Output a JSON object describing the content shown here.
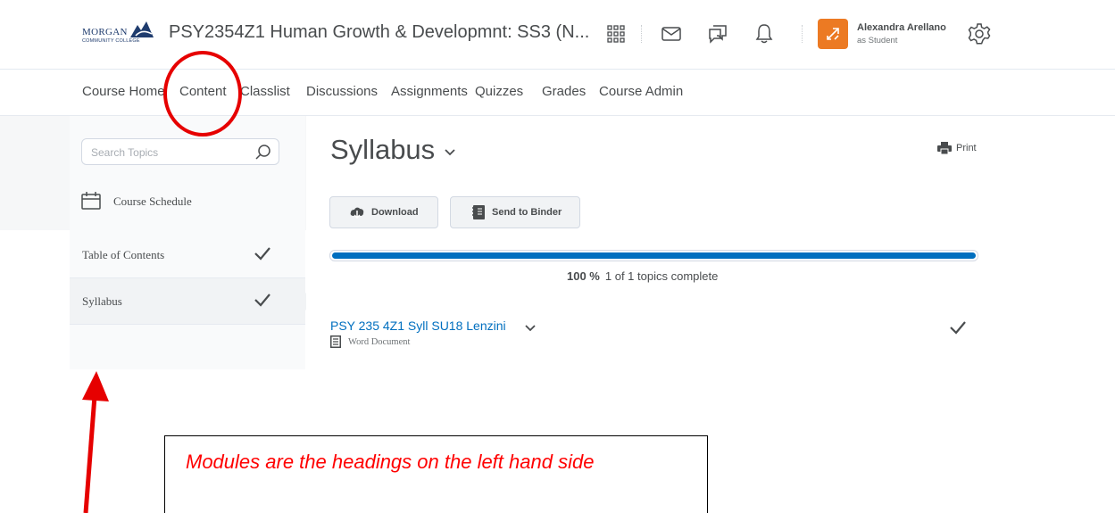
{
  "header": {
    "logo_text": "MORGAN",
    "logo_subtext": "COMMUNITY COLLEGE",
    "course_title": "PSY2354Z1 Human Growth & Developmnt: SS3 (N...",
    "icons": [
      "apps-grid-icon",
      "mail-icon",
      "chat-icon",
      "bell-icon"
    ],
    "user": {
      "name": "Alexandra Arellano",
      "role": "as Student",
      "avatar_color": "#ec7a23"
    },
    "settings_icon": "gear-icon"
  },
  "course_nav": {
    "items": [
      "Course Home",
      "Content",
      "Classlist",
      "Discussions",
      "Assignments",
      "Quizzes",
      "Grades",
      "Course Admin"
    ]
  },
  "sidebar": {
    "search_placeholder": "Search Topics",
    "schedule_label": "Course Schedule",
    "items": [
      {
        "label": "Table of Contents",
        "completed": true
      },
      {
        "label": "Syllabus",
        "completed": true,
        "active": true
      }
    ]
  },
  "main": {
    "title": "Syllabus",
    "print_label": "Print",
    "buttons": {
      "download": "Download",
      "binder": "Send to Binder"
    },
    "progress": {
      "percent_label": "100 %",
      "percent": 100,
      "detail": "1 of 1 topics complete",
      "bar_color": "#006fbf"
    },
    "topic": {
      "title": "PSY 235 4Z1 Syll SU18 Lenzini",
      "type": "Word Document",
      "completed": true
    }
  },
  "annotation": {
    "callout_text": "Modules are the headings on the left hand side",
    "color": "#ff0000"
  }
}
